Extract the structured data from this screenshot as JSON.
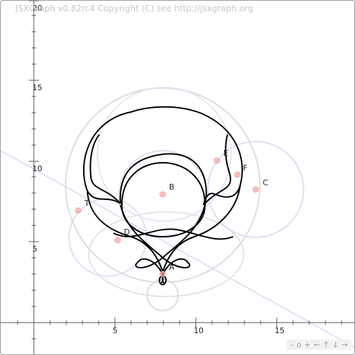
{
  "board": {
    "copyright": "JSXGraph v0.82rc4 Copyright (C) see http://jsxgraph.org",
    "navigation": [
      {
        "id": "zoom-out",
        "label": "–",
        "icon": "minus-icon"
      },
      {
        "id": "zoom-reset",
        "label": "o",
        "icon": "reset-icon"
      },
      {
        "id": "zoom-in",
        "label": "+",
        "icon": "plus-icon"
      },
      {
        "id": "pan-left",
        "label": "←",
        "icon": "arrow-left-icon"
      },
      {
        "id": "pan-up",
        "label": "↑",
        "icon": "arrow-up-icon"
      },
      {
        "id": "pan-down",
        "label": "↓",
        "icon": "arrow-down-icon"
      },
      {
        "id": "pan-right",
        "label": "→",
        "icon": "arrow-right-icon"
      }
    ]
  },
  "axes": {
    "x_ticks": [
      "5",
      "10",
      "15"
    ],
    "y_ticks": [
      "5",
      "10",
      "15",
      "20"
    ]
  },
  "points": [
    {
      "name": "A",
      "label": "A"
    },
    {
      "name": "B",
      "label": "B"
    },
    {
      "name": "C",
      "label": "C"
    },
    {
      "name": "D",
      "label": "D"
    },
    {
      "name": "E",
      "label": "E"
    },
    {
      "name": "F",
      "label": "F"
    },
    {
      "name": "T",
      "label": "T"
    }
  ],
  "colors": {
    "point": "#f4a6a6",
    "curve": "#000000",
    "circle_gray": "#d9d9d9",
    "circle_blue": "#d0d0f0",
    "line": "#c8c8ee",
    "axis": "#555555"
  }
}
